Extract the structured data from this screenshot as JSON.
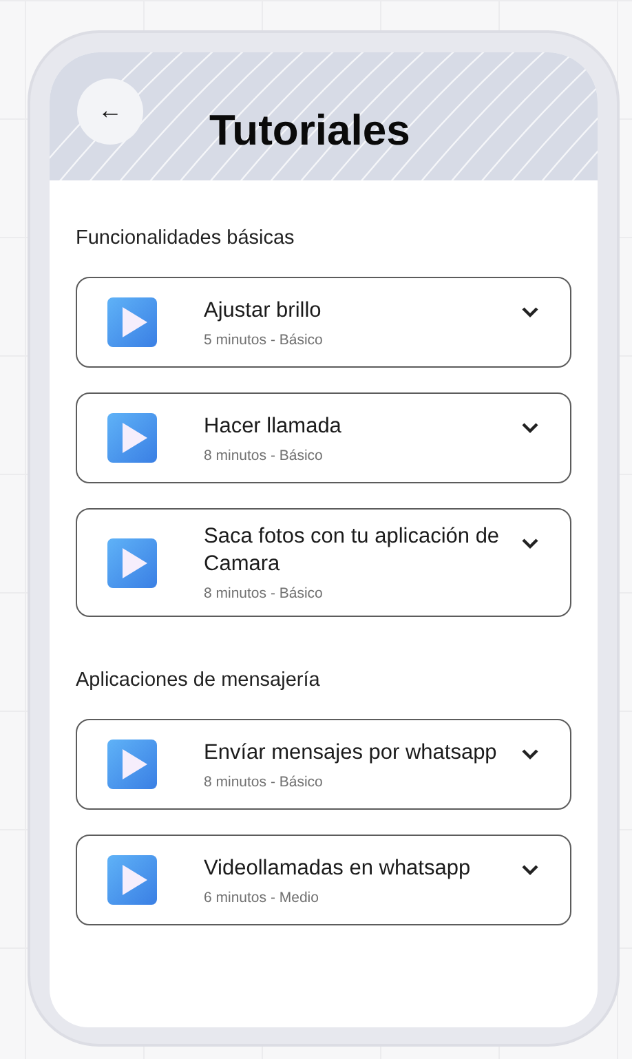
{
  "header": {
    "back_icon": "←",
    "title": "Tutoriales"
  },
  "sections": [
    {
      "title": "Funcionalidades básicas",
      "tutorials": [
        {
          "title": "Ajustar brillo",
          "meta": "5 minutos - Básico"
        },
        {
          "title": "Hacer llamada",
          "meta": "8 minutos - Básico"
        },
        {
          "title": "Saca fotos con tu aplicación de Camara",
          "meta": "8 minutos - Básico"
        }
      ]
    },
    {
      "title": "Aplicaciones de mensajería",
      "tutorials": [
        {
          "title": "Envíar mensajes por whatsapp",
          "meta": "8 minutos - Básico"
        },
        {
          "title": "Videollamadas en whatsapp",
          "meta": "6 minutos - Medio"
        }
      ]
    }
  ]
}
